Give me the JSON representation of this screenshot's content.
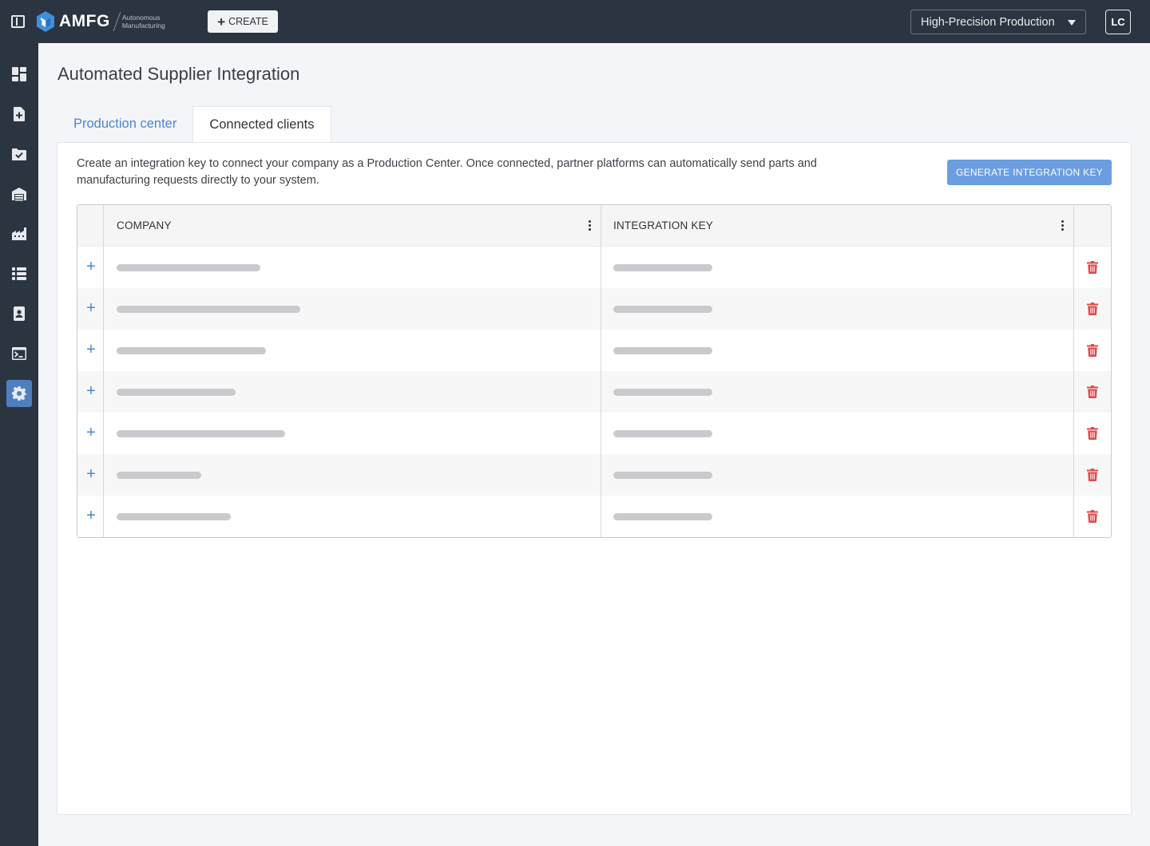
{
  "header": {
    "logo_text": "AMFG",
    "logo_sub_line1": "Autonomous",
    "logo_sub_line2": "Manufacturing",
    "create_label": "CREATE",
    "production_center": "High-Precision Production",
    "user_initials": "LC"
  },
  "sidebar": {
    "items": [
      {
        "name": "dashboard-icon"
      },
      {
        "name": "new-document-icon"
      },
      {
        "name": "approved-folder-icon"
      },
      {
        "name": "warehouse-icon"
      },
      {
        "name": "factory-icon"
      },
      {
        "name": "list-icon"
      },
      {
        "name": "contacts-icon"
      },
      {
        "name": "terminal-icon"
      },
      {
        "name": "settings-icon",
        "active": true
      }
    ]
  },
  "page": {
    "title": "Automated Supplier Integration",
    "tabs": [
      {
        "label": "Production center",
        "active": false
      },
      {
        "label": "Connected clients",
        "active": true
      }
    ],
    "description": "Create an integration key to connect your company as a Production Center. Once connected, partner platforms can automatically send parts and manufacturing requests directly to your system.",
    "generate_button": "GENERATE INTEGRATION KEY"
  },
  "table": {
    "columns": [
      {
        "label": "COMPANY"
      },
      {
        "label": "INTEGRATION KEY"
      }
    ],
    "rows": [
      {
        "company_placeholder_fraction": 0.29,
        "key_placeholder_fraction": 0.21
      },
      {
        "company_placeholder_fraction": 0.37,
        "key_placeholder_fraction": 0.21
      },
      {
        "company_placeholder_fraction": 0.3,
        "key_placeholder_fraction": 0.21
      },
      {
        "company_placeholder_fraction": 0.24,
        "key_placeholder_fraction": 0.21
      },
      {
        "company_placeholder_fraction": 0.34,
        "key_placeholder_fraction": 0.21
      },
      {
        "company_placeholder_fraction": 0.17,
        "key_placeholder_fraction": 0.21
      },
      {
        "company_placeholder_fraction": 0.23,
        "key_placeholder_fraction": 0.21
      }
    ]
  },
  "colors": {
    "topbar": "#2b3541",
    "accent": "#4a86d0",
    "button": "#6b9ee0",
    "delete": "#e04b4b",
    "placeholder": "#c9cacd"
  }
}
